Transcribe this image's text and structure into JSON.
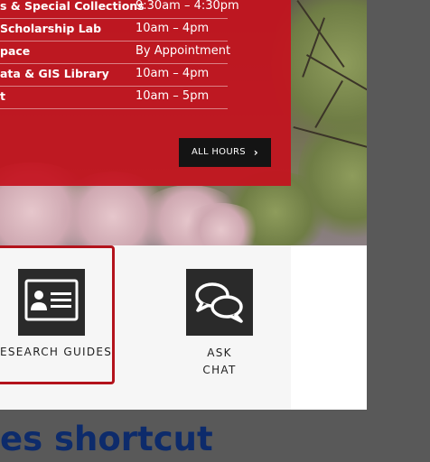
{
  "hours": {
    "rows": [
      {
        "location": "s & Special Collections",
        "time": "9:30am – 4:30pm"
      },
      {
        "location": "Scholarship Lab",
        "time": "10am – 4pm"
      },
      {
        "location": "pace",
        "time": "By Appointment"
      },
      {
        "location": "ata & GIS Library",
        "time": "10am – 4pm"
      },
      {
        "location": "t",
        "time": "10am – 5pm"
      }
    ],
    "all_hours_label": "ALL HOURS",
    "panel_color": "#c4121e"
  },
  "shortcuts": {
    "research_guides_label": "ESEARCH GUIDES",
    "ask_chat_line1": "ASK",
    "ask_chat_line2": "CHAT",
    "highlight_color": "#b3131c"
  },
  "section": {
    "heading": "es shortcut"
  },
  "icons": {
    "research_guides": "id-card-icon",
    "ask_chat": "chat-bubbles-icon",
    "all_hours": "chevron-right-icon"
  }
}
